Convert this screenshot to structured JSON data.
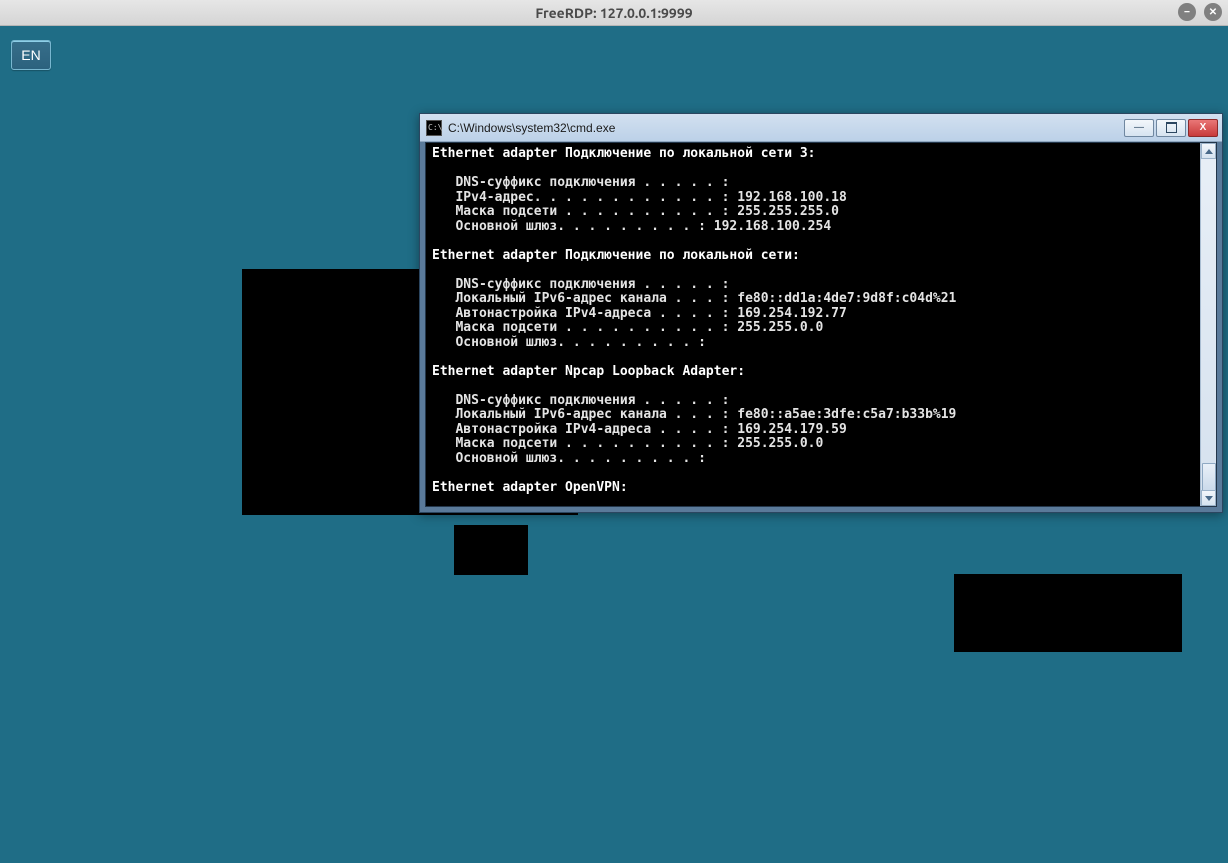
{
  "outer_window": {
    "title": "FreeRDP: 127.0.0.1:9999"
  },
  "lang_indicator": {
    "label": "EN"
  },
  "cmd_window": {
    "title": "C:\\Windows\\system32\\cmd.exe",
    "icon_glyph": "C:\\"
  },
  "ipconfig": {
    "adapters": [
      {
        "header": "Ethernet adapter Подключение по локальной сети 3:",
        "lines": [
          "   DNS-суффикс подключения . . . . . :",
          "   IPv4-адрес. . . . . . . . . . . . : 192.168.100.18",
          "   Маска подсети . . . . . . . . . . : 255.255.255.0",
          "   Основной шлюз. . . . . . . . . : 192.168.100.254"
        ]
      },
      {
        "header": "Ethernet adapter Подключение по локальной сети:",
        "lines": [
          "   DNS-суффикс подключения . . . . . :",
          "   Локальный IPv6-адрес канала . . . : fe80::dd1a:4de7:9d8f:c04d%21",
          "   Автонастройка IPv4-адреса . . . . : 169.254.192.77",
          "   Маска подсети . . . . . . . . . . : 255.255.0.0",
          "   Основной шлюз. . . . . . . . . :"
        ]
      },
      {
        "header": "Ethernet adapter Npcap Loopback Adapter:",
        "lines": [
          "   DNS-суффикс подключения . . . . . :",
          "   Локальный IPv6-адрес канала . . . : fe80::a5ae:3dfe:c5a7:b33b%19",
          "   Автонастройка IPv4-адреса . . . . : 169.254.179.59",
          "   Маска подсети . . . . . . . . . . : 255.255.0.0",
          "   Основной шлюз. . . . . . . . . :"
        ]
      },
      {
        "header": "Ethernet adapter OpenVPN:",
        "lines": []
      }
    ]
  }
}
